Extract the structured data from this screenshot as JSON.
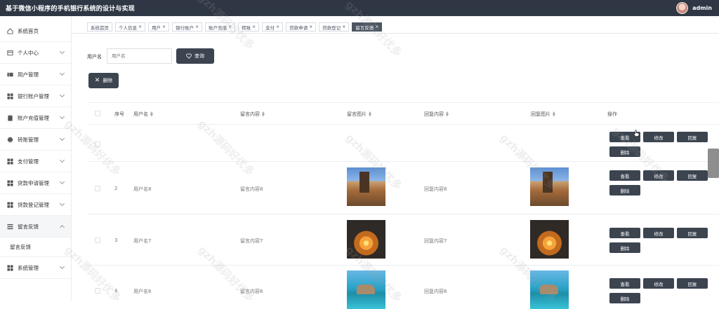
{
  "header": {
    "title": "基于微信小程序的手机银行系统的设计与实现",
    "username": "admin"
  },
  "sidebar": {
    "items": [
      {
        "label": "系统首页",
        "icon": "home-icon",
        "expandable": false
      },
      {
        "label": "个人中心",
        "icon": "user-card-icon",
        "expandable": true
      },
      {
        "label": "用户管理",
        "icon": "users-icon",
        "expandable": true
      },
      {
        "label": "银行账户管理",
        "icon": "grid-icon",
        "expandable": true
      },
      {
        "label": "账户充值管理",
        "icon": "clipboard-icon",
        "expandable": true
      },
      {
        "label": "转账管理",
        "icon": "printer-icon",
        "expandable": true
      },
      {
        "label": "支付管理",
        "icon": "grid-icon",
        "expandable": true
      },
      {
        "label": "贷款申请管理",
        "icon": "grid-icon",
        "expandable": true
      },
      {
        "label": "贷款登记管理",
        "icon": "grid-icon",
        "expandable": true
      },
      {
        "label": "留言反馈",
        "icon": "list-icon",
        "expandable": true,
        "open": true
      }
    ],
    "subitem": "留言反馈",
    "last_item": {
      "label": "系统管理",
      "icon": "grid-icon"
    }
  },
  "tabs": [
    {
      "label": "系统首页",
      "closable": false
    },
    {
      "label": "个人信息",
      "closable": true
    },
    {
      "label": "用户",
      "closable": true
    },
    {
      "label": "银行账户",
      "closable": true
    },
    {
      "label": "账户充值",
      "closable": true
    },
    {
      "label": "转账",
      "closable": true
    },
    {
      "label": "支付",
      "closable": true
    },
    {
      "label": "贷款申请",
      "closable": true
    },
    {
      "label": "贷款登记",
      "closable": true
    },
    {
      "label": "留言反馈",
      "closable": true,
      "active": true
    }
  ],
  "search": {
    "label": "用户名",
    "placeholder": "用户名",
    "query_label": "查询"
  },
  "toolbar": {
    "delete_label": "删除"
  },
  "table": {
    "columns": [
      "序号",
      "用户名",
      "留言内容",
      "留言图片",
      "回复内容",
      "回复图片",
      "操作"
    ],
    "rows": [
      {
        "index": "",
        "username": "",
        "message": "",
        "reply": "",
        "image": ""
      },
      {
        "index": "2",
        "username": "用户名8",
        "message": "留言内容8",
        "reply": "回复内容8",
        "image": "castle"
      },
      {
        "index": "3",
        "username": "用户名7",
        "message": "留言内容7",
        "reply": "回复内容7",
        "image": "sunset"
      },
      {
        "index": "4",
        "username": "用户名6",
        "message": "留言内容6",
        "reply": "回复内容6",
        "image": "sea"
      }
    ],
    "actions": {
      "view": "查看",
      "edit": "修改",
      "reply": "回复",
      "delete": "删除"
    }
  },
  "watermark": "gzh源码好优多"
}
